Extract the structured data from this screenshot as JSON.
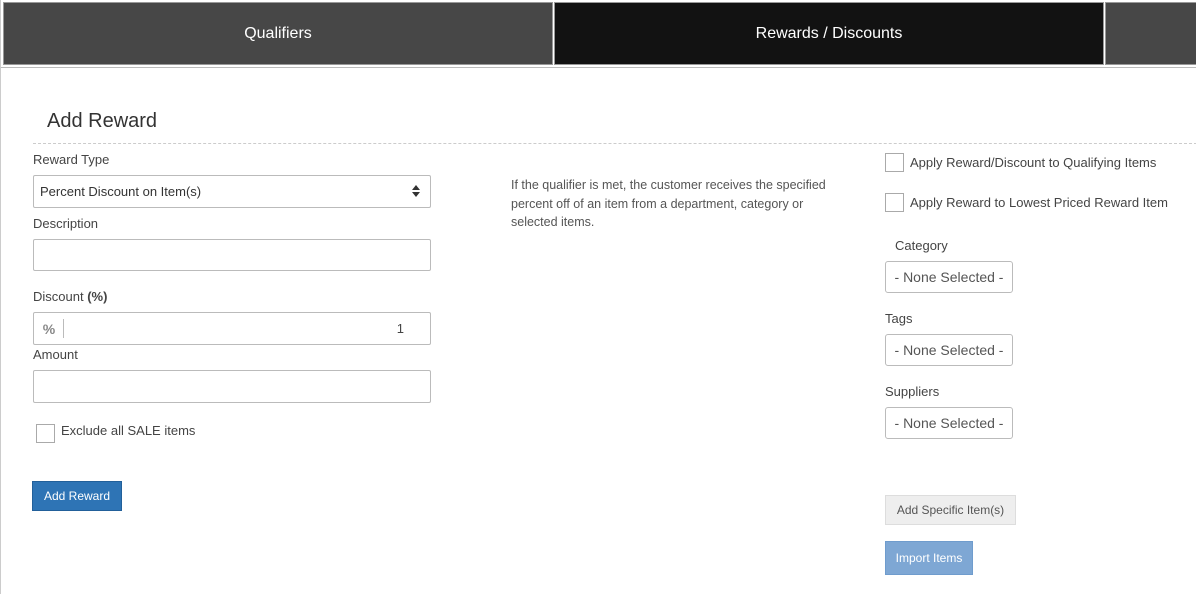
{
  "tabs": [
    {
      "label": "Qualifiers"
    },
    {
      "label": "Rewards / Discounts"
    }
  ],
  "section": {
    "title": "Add Reward"
  },
  "form": {
    "reward_type_label": "Reward Type",
    "reward_type_value": "Percent Discount on Item(s)",
    "description_label": "Description",
    "description_value": "",
    "discount_label": "Discount",
    "discount_unit": "(%)",
    "discount_addon": "%",
    "discount_value": "1",
    "amount_label": "Amount",
    "amount_value": "",
    "exclude_sale_label": "Exclude all SALE items",
    "add_reward_button": "Add Reward"
  },
  "help_text": "If the qualifier is met, the customer receives the specified percent off of an item from a department, category or selected items.",
  "right": {
    "apply_qualifying_label": "Apply Reward/Discount to Qualifying Items",
    "apply_lowest_label": "Apply Reward to Lowest Priced Reward Item",
    "category_label": "Category",
    "category_value": "- None Selected -",
    "tags_label": "Tags",
    "tags_value": "- None Selected -",
    "suppliers_label": "Suppliers",
    "suppliers_value": "- None Selected -",
    "add_specific_button": "Add Specific Item(s)",
    "import_button": "Import Items"
  },
  "colors": {
    "tab_active": "#121212",
    "tab_inactive": "#474747",
    "primary": "#2e74b5",
    "primary_disabled": "#7ea7d4"
  }
}
